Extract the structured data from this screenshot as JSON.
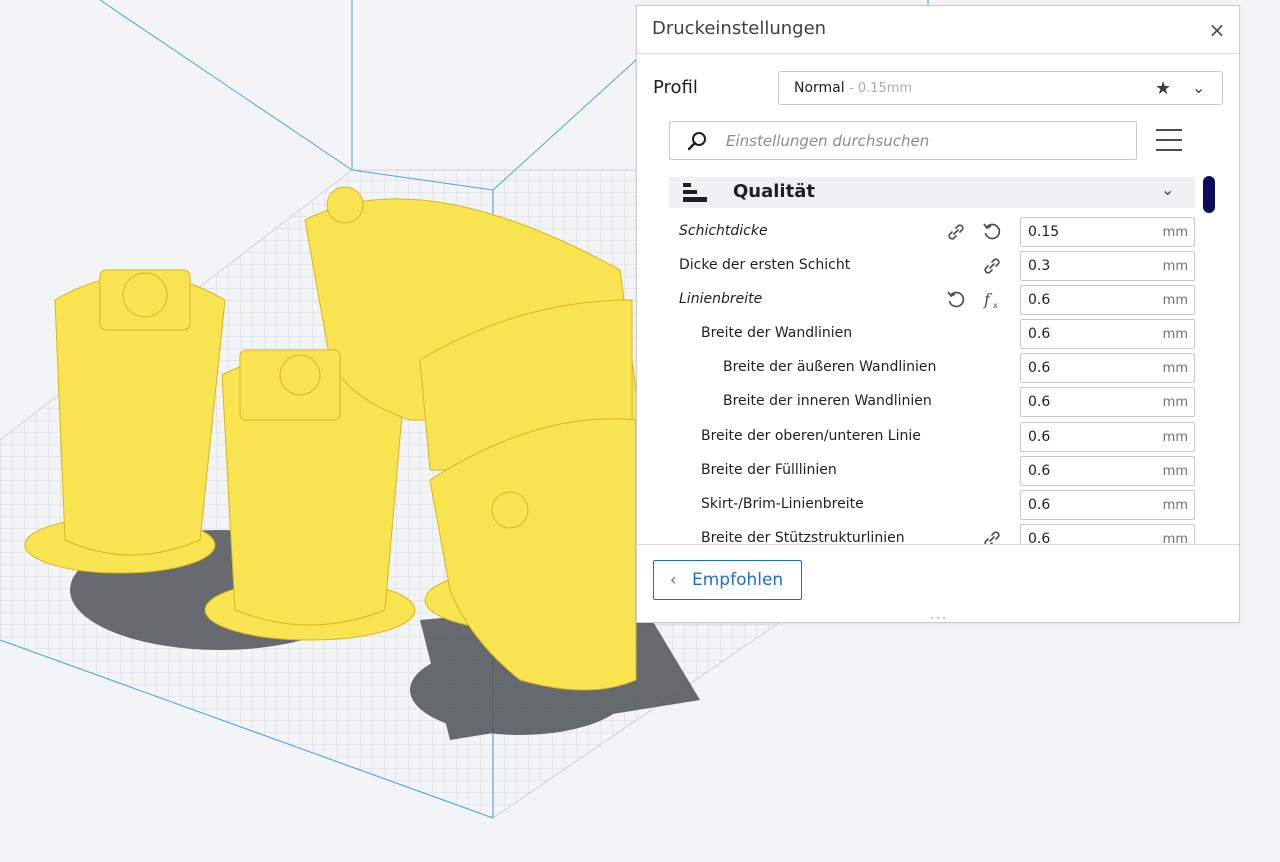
{
  "colors": {
    "accent": "#1a6fd6",
    "model": "#f8e350",
    "scrollbar": "#0b0c5e",
    "build_plate_grid": "#d6d8dc"
  },
  "panel": {
    "title": "Druckeinstellungen",
    "close_icon": "close-icon",
    "profile": {
      "label": "Profil",
      "name": "Normal",
      "layer": "- 0.15mm",
      "icons": [
        "star-icon",
        "chevron-down-icon"
      ]
    },
    "search": {
      "placeholder": "Einstellungen durchsuchen"
    },
    "category": {
      "label": "Qualität",
      "icon": "quality-icon"
    },
    "settings": [
      {
        "label": "Schichtdicke",
        "value": "0.15",
        "unit": "mm",
        "icons": [
          "link-icon",
          "reset-icon"
        ]
      },
      {
        "label": "Dicke der ersten Schicht",
        "value": "0.3",
        "unit": "mm",
        "icons": [
          "link-icon"
        ]
      },
      {
        "label": "Linienbreite",
        "value": "0.6",
        "unit": "mm",
        "icons": [
          "reset-icon",
          "function-icon"
        ]
      },
      {
        "label": "Breite der Wandlinien",
        "value": "0.6",
        "unit": "mm",
        "icons": []
      },
      {
        "label": "Breite der äußeren Wandlinien",
        "value": "0.6",
        "unit": "mm",
        "icons": []
      },
      {
        "label": "Breite der inneren Wandlinien",
        "value": "0.6",
        "unit": "mm",
        "icons": []
      },
      {
        "label": "Breite der oberen/unteren Linie",
        "value": "0.6",
        "unit": "mm",
        "icons": []
      },
      {
        "label": "Breite der Fülllinien",
        "value": "0.6",
        "unit": "mm",
        "icons": []
      },
      {
        "label": "Skirt-/Brim-Linienbreite",
        "value": "0.6",
        "unit": "mm",
        "icons": []
      },
      {
        "label": "Breite der Stützstrukturlinien",
        "value": "0.6",
        "unit": "mm",
        "icons": [
          "link-icon"
        ]
      }
    ],
    "footer": {
      "back_label": "Empfohlen"
    }
  }
}
